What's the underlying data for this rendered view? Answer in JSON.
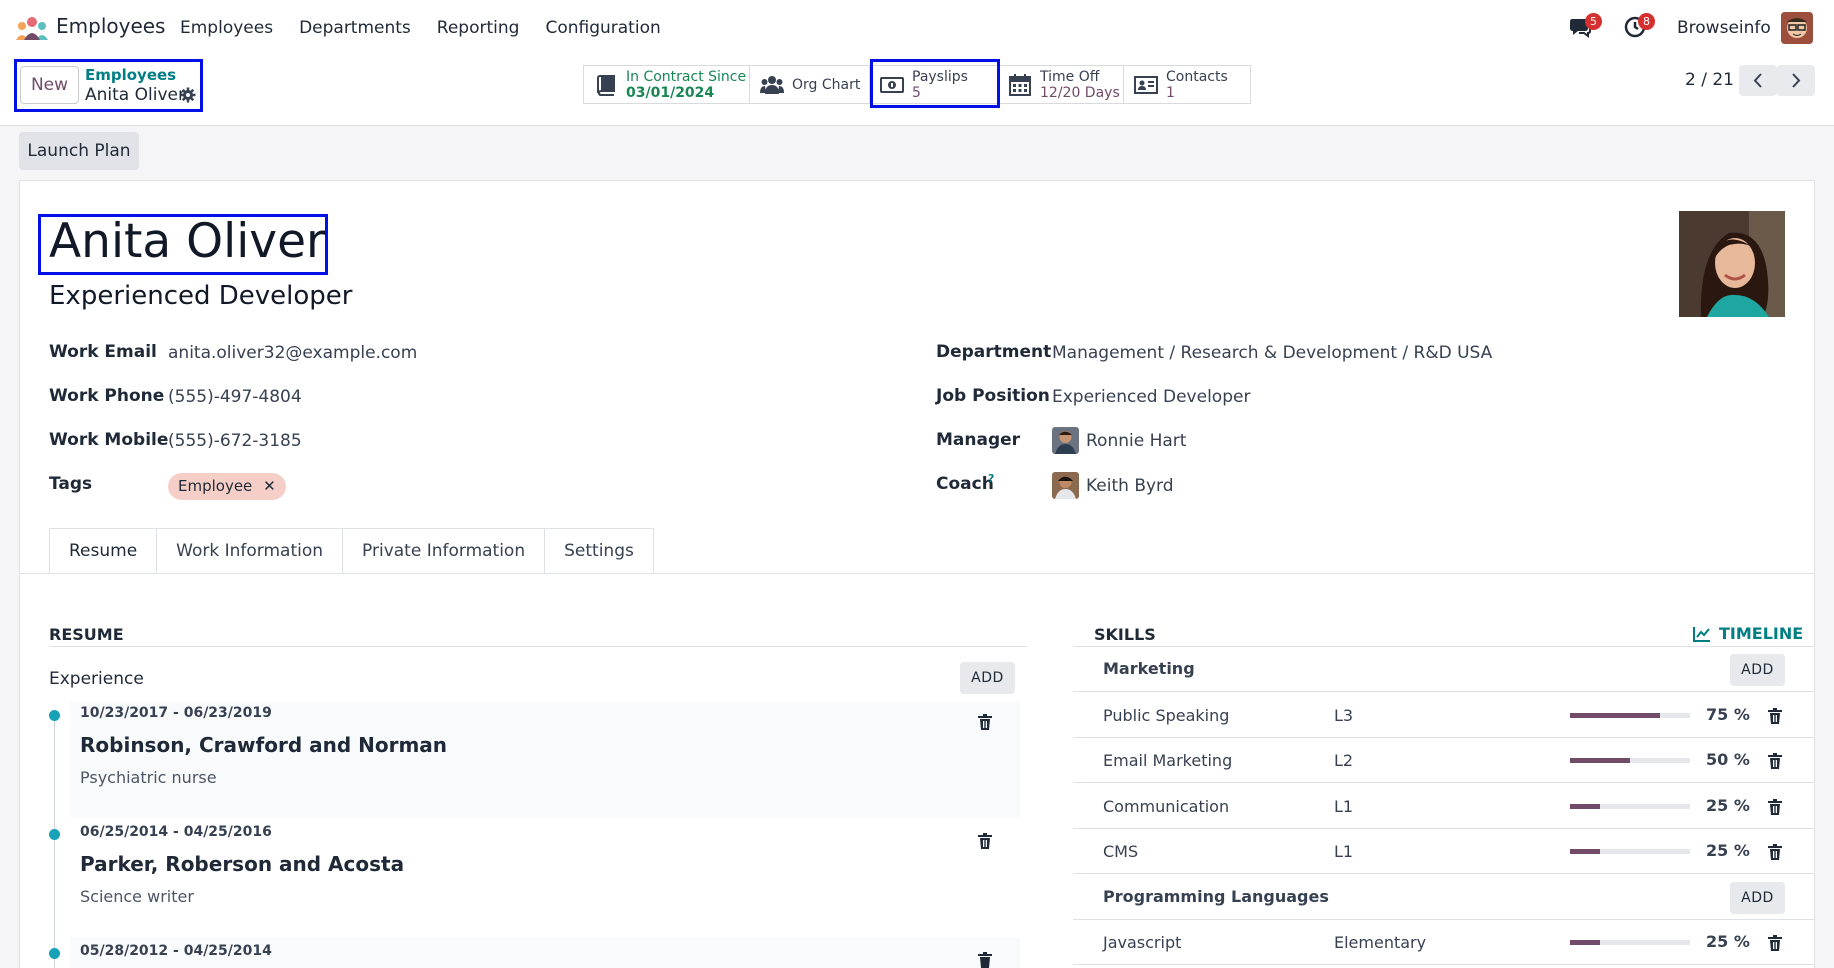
{
  "navbar": {
    "app_name": "Employees",
    "menu": [
      "Employees",
      "Departments",
      "Reporting",
      "Configuration"
    ],
    "chat_count": "5",
    "activity_count": "8",
    "company": "Browseinfo"
  },
  "control": {
    "new_label": "New",
    "breadcrumb_parent": "Employees",
    "breadcrumb_current": "Anita Oliver",
    "smart_buttons": [
      {
        "label": "In Contract Since",
        "value": "03/01/2024",
        "icon": "book-icon"
      },
      {
        "label": "Org Chart",
        "value": "",
        "icon": "users-icon"
      },
      {
        "label": "Payslips",
        "value": "5",
        "icon": "money-icon"
      },
      {
        "label": "Time Off",
        "value": "12/20 Days",
        "icon": "calendar-icon"
      },
      {
        "label": "Contacts",
        "value": "1",
        "icon": "address-card-icon"
      }
    ],
    "pager": "2 / 21"
  },
  "actions": {
    "launch_plan": "Launch Plan"
  },
  "employee": {
    "name": "Anita Oliver",
    "job_title": "Experienced Developer",
    "fields_left": [
      {
        "label": "Work Email",
        "value": "anita.oliver32@example.com"
      },
      {
        "label": "Work Phone",
        "value": "(555)-497-4804"
      },
      {
        "label": "Work Mobile",
        "value": "(555)-672-3185"
      },
      {
        "label": "Tags",
        "value": ""
      }
    ],
    "tag": "Employee",
    "fields_right": [
      {
        "label": "Department",
        "value": "Management / Research & Development / R&D USA"
      },
      {
        "label": "Job Position",
        "value": "Experienced Developer"
      },
      {
        "label": "Manager",
        "value": "Ronnie Hart"
      },
      {
        "label": "Coach",
        "value": "Keith Byrd"
      }
    ],
    "coach_help": "?"
  },
  "tabs": [
    "Resume",
    "Work Information",
    "Private Information",
    "Settings"
  ],
  "resume": {
    "title": "RESUME",
    "group": "Experience",
    "add": "ADD",
    "entries": [
      {
        "dates": "10/23/2017 - 06/23/2019",
        "company": "Robinson, Crawford and Norman",
        "role": "Psychiatric nurse"
      },
      {
        "dates": "06/25/2014 - 04/25/2016",
        "company": "Parker, Roberson and Acosta",
        "role": "Science writer"
      },
      {
        "dates": "05/28/2012 - 04/25/2014",
        "company": "",
        "role": ""
      }
    ]
  },
  "skills": {
    "title": "SKILLS",
    "timeline": "TIMELINE",
    "add": "ADD",
    "groups": [
      {
        "name": "Marketing",
        "items": [
          {
            "name": "Public Speaking",
            "level": "L3",
            "progress": 75,
            "pct_label": "75 %"
          },
          {
            "name": "Email Marketing",
            "level": "L2",
            "progress": 50,
            "pct_label": "50 %"
          },
          {
            "name": "Communication",
            "level": "L1",
            "progress": 25,
            "pct_label": "25 %"
          },
          {
            "name": "CMS",
            "level": "L1",
            "progress": 25,
            "pct_label": "25 %"
          }
        ]
      },
      {
        "name": "Programming Languages",
        "items": [
          {
            "name": "Javascript",
            "level": "Elementary",
            "progress": 25,
            "pct_label": "25 %"
          }
        ]
      }
    ]
  },
  "colors": {
    "accent": "#714b67",
    "teal": "#017e84",
    "highlight": "#0010e6",
    "badge": "#d62f2f"
  }
}
